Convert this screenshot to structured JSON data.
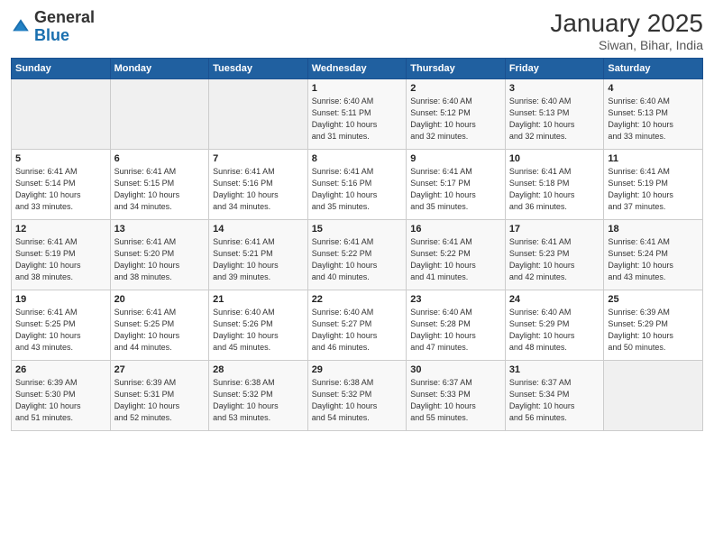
{
  "header": {
    "logo_general": "General",
    "logo_blue": "Blue",
    "month_title": "January 2025",
    "location": "Siwan, Bihar, India"
  },
  "days_of_week": [
    "Sunday",
    "Monday",
    "Tuesday",
    "Wednesday",
    "Thursday",
    "Friday",
    "Saturday"
  ],
  "weeks": [
    [
      {
        "day": "",
        "info": ""
      },
      {
        "day": "",
        "info": ""
      },
      {
        "day": "",
        "info": ""
      },
      {
        "day": "1",
        "info": "Sunrise: 6:40 AM\nSunset: 5:11 PM\nDaylight: 10 hours\nand 31 minutes."
      },
      {
        "day": "2",
        "info": "Sunrise: 6:40 AM\nSunset: 5:12 PM\nDaylight: 10 hours\nand 32 minutes."
      },
      {
        "day": "3",
        "info": "Sunrise: 6:40 AM\nSunset: 5:13 PM\nDaylight: 10 hours\nand 32 minutes."
      },
      {
        "day": "4",
        "info": "Sunrise: 6:40 AM\nSunset: 5:13 PM\nDaylight: 10 hours\nand 33 minutes."
      }
    ],
    [
      {
        "day": "5",
        "info": "Sunrise: 6:41 AM\nSunset: 5:14 PM\nDaylight: 10 hours\nand 33 minutes."
      },
      {
        "day": "6",
        "info": "Sunrise: 6:41 AM\nSunset: 5:15 PM\nDaylight: 10 hours\nand 34 minutes."
      },
      {
        "day": "7",
        "info": "Sunrise: 6:41 AM\nSunset: 5:16 PM\nDaylight: 10 hours\nand 34 minutes."
      },
      {
        "day": "8",
        "info": "Sunrise: 6:41 AM\nSunset: 5:16 PM\nDaylight: 10 hours\nand 35 minutes."
      },
      {
        "day": "9",
        "info": "Sunrise: 6:41 AM\nSunset: 5:17 PM\nDaylight: 10 hours\nand 35 minutes."
      },
      {
        "day": "10",
        "info": "Sunrise: 6:41 AM\nSunset: 5:18 PM\nDaylight: 10 hours\nand 36 minutes."
      },
      {
        "day": "11",
        "info": "Sunrise: 6:41 AM\nSunset: 5:19 PM\nDaylight: 10 hours\nand 37 minutes."
      }
    ],
    [
      {
        "day": "12",
        "info": "Sunrise: 6:41 AM\nSunset: 5:19 PM\nDaylight: 10 hours\nand 38 minutes."
      },
      {
        "day": "13",
        "info": "Sunrise: 6:41 AM\nSunset: 5:20 PM\nDaylight: 10 hours\nand 38 minutes."
      },
      {
        "day": "14",
        "info": "Sunrise: 6:41 AM\nSunset: 5:21 PM\nDaylight: 10 hours\nand 39 minutes."
      },
      {
        "day": "15",
        "info": "Sunrise: 6:41 AM\nSunset: 5:22 PM\nDaylight: 10 hours\nand 40 minutes."
      },
      {
        "day": "16",
        "info": "Sunrise: 6:41 AM\nSunset: 5:22 PM\nDaylight: 10 hours\nand 41 minutes."
      },
      {
        "day": "17",
        "info": "Sunrise: 6:41 AM\nSunset: 5:23 PM\nDaylight: 10 hours\nand 42 minutes."
      },
      {
        "day": "18",
        "info": "Sunrise: 6:41 AM\nSunset: 5:24 PM\nDaylight: 10 hours\nand 43 minutes."
      }
    ],
    [
      {
        "day": "19",
        "info": "Sunrise: 6:41 AM\nSunset: 5:25 PM\nDaylight: 10 hours\nand 43 minutes."
      },
      {
        "day": "20",
        "info": "Sunrise: 6:41 AM\nSunset: 5:25 PM\nDaylight: 10 hours\nand 44 minutes."
      },
      {
        "day": "21",
        "info": "Sunrise: 6:40 AM\nSunset: 5:26 PM\nDaylight: 10 hours\nand 45 minutes."
      },
      {
        "day": "22",
        "info": "Sunrise: 6:40 AM\nSunset: 5:27 PM\nDaylight: 10 hours\nand 46 minutes."
      },
      {
        "day": "23",
        "info": "Sunrise: 6:40 AM\nSunset: 5:28 PM\nDaylight: 10 hours\nand 47 minutes."
      },
      {
        "day": "24",
        "info": "Sunrise: 6:40 AM\nSunset: 5:29 PM\nDaylight: 10 hours\nand 48 minutes."
      },
      {
        "day": "25",
        "info": "Sunrise: 6:39 AM\nSunset: 5:29 PM\nDaylight: 10 hours\nand 50 minutes."
      }
    ],
    [
      {
        "day": "26",
        "info": "Sunrise: 6:39 AM\nSunset: 5:30 PM\nDaylight: 10 hours\nand 51 minutes."
      },
      {
        "day": "27",
        "info": "Sunrise: 6:39 AM\nSunset: 5:31 PM\nDaylight: 10 hours\nand 52 minutes."
      },
      {
        "day": "28",
        "info": "Sunrise: 6:38 AM\nSunset: 5:32 PM\nDaylight: 10 hours\nand 53 minutes."
      },
      {
        "day": "29",
        "info": "Sunrise: 6:38 AM\nSunset: 5:32 PM\nDaylight: 10 hours\nand 54 minutes."
      },
      {
        "day": "30",
        "info": "Sunrise: 6:37 AM\nSunset: 5:33 PM\nDaylight: 10 hours\nand 55 minutes."
      },
      {
        "day": "31",
        "info": "Sunrise: 6:37 AM\nSunset: 5:34 PM\nDaylight: 10 hours\nand 56 minutes."
      },
      {
        "day": "",
        "info": ""
      }
    ]
  ]
}
